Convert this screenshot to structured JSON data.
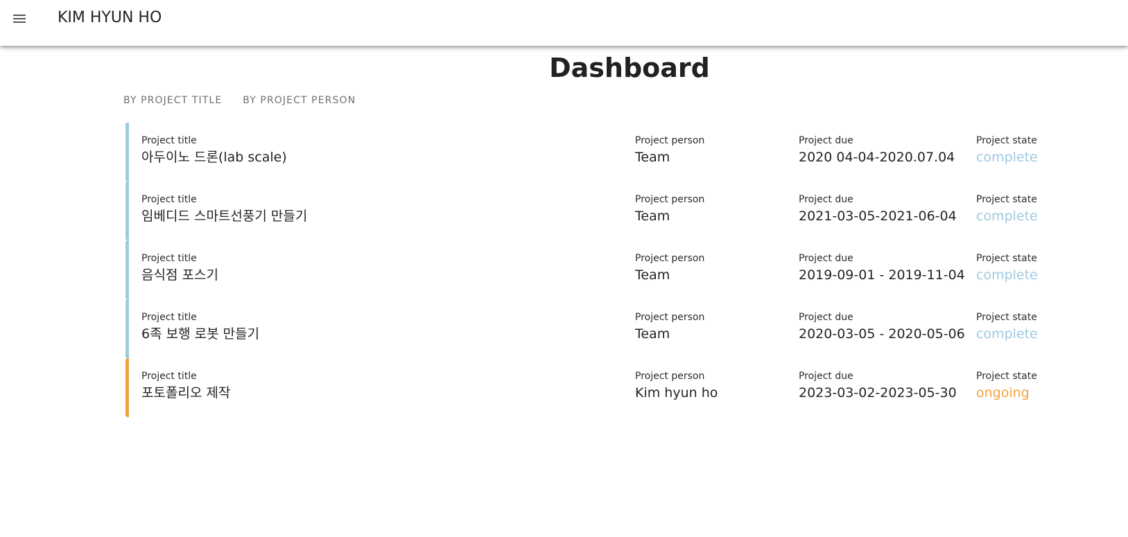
{
  "header": {
    "menu_icon": "hamburger-menu-icon",
    "title": "KIM HYUN HO"
  },
  "page": {
    "title": "Dashboard"
  },
  "tabs": [
    {
      "label": "BY PROJECT TITLE"
    },
    {
      "label": "BY PROJECT PERSON"
    }
  ],
  "columns": {
    "title": "Project title",
    "person": "Project person",
    "due": "Project due",
    "state": "Project state"
  },
  "colors": {
    "complete": "#9ecae1",
    "ongoing": "#f0a33c"
  },
  "projects": [
    {
      "title": "아두이노 드론(lab scale)",
      "person": "Team",
      "due": "2020 04-04-2020.07.04",
      "state": "complete"
    },
    {
      "title": "임베디드 스마트선풍기 만들기",
      "person": "Team",
      "due": "2021-03-05-2021-06-04",
      "state": "complete"
    },
    {
      "title": "음식점 포스기",
      "person": "Team",
      "due": "2019-09-01 - 2019-11-04",
      "state": "complete"
    },
    {
      "title": "6족 보행 로봇 만들기",
      "person": "Team",
      "due": "2020-03-05 - 2020-05-06",
      "state": "complete"
    },
    {
      "title": "포토폴리오 제작",
      "person": "Kim hyun ho",
      "due": "2023-03-02-2023-05-30",
      "state": "ongoing"
    }
  ]
}
